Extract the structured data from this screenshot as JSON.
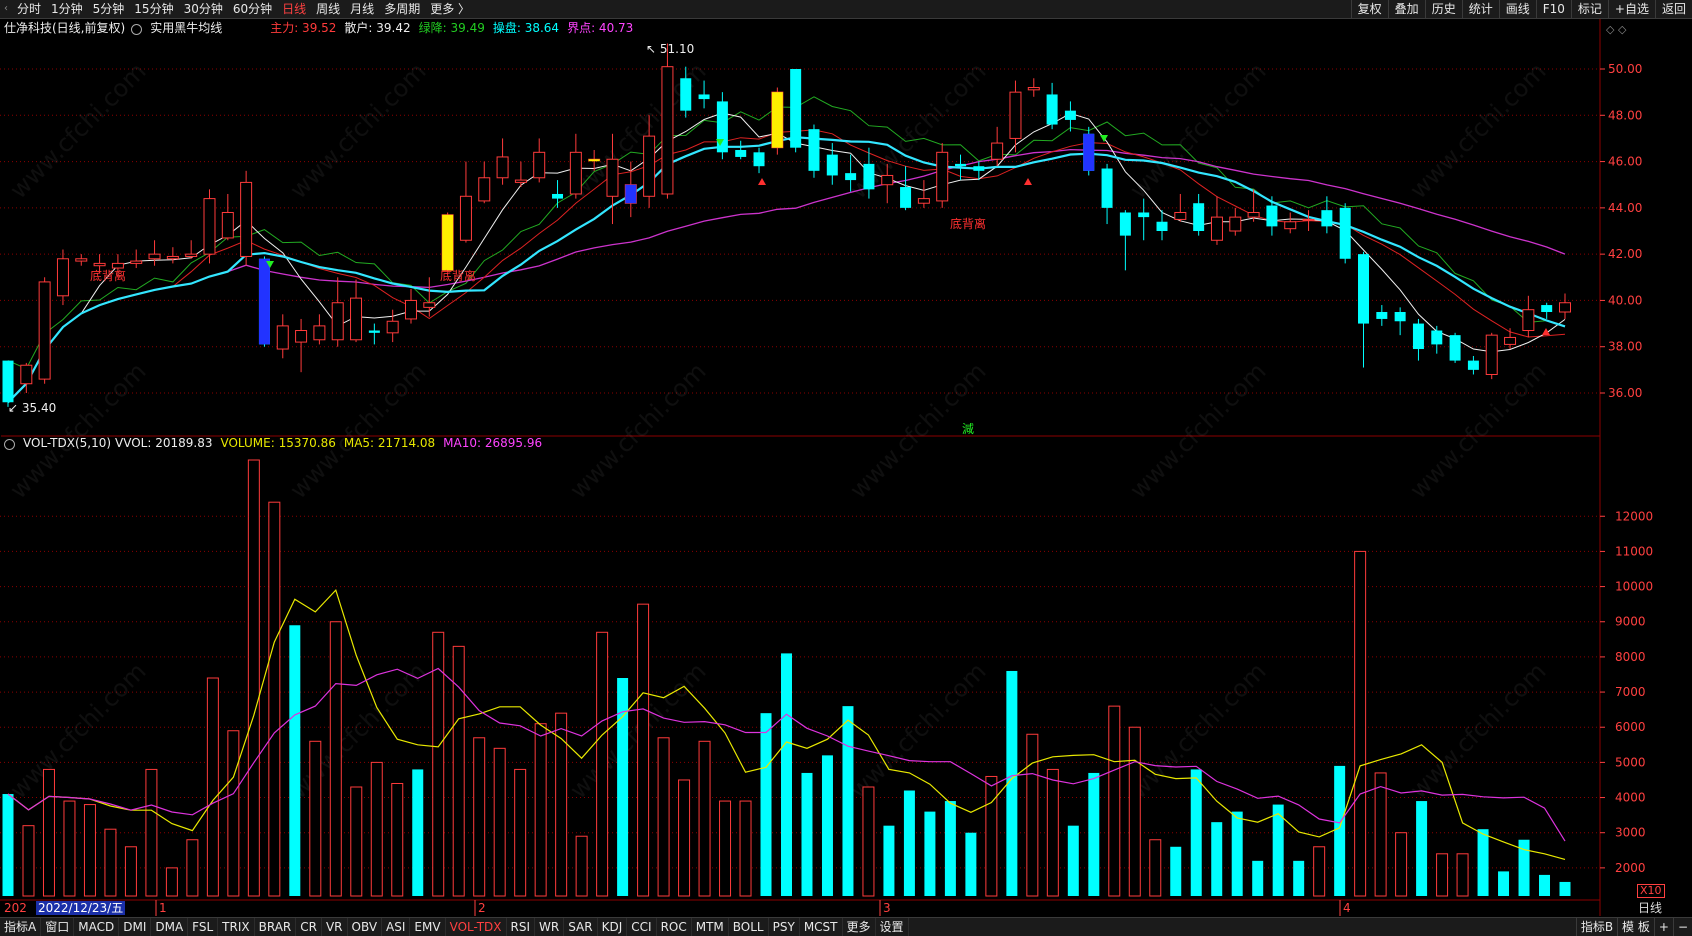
{
  "toolbar": {
    "periods": [
      "分时",
      "1分钟",
      "5分钟",
      "15分钟",
      "30分钟",
      "60分钟",
      "日线",
      "周线",
      "月线",
      "多周期",
      "更多 〉"
    ],
    "active_period": "日线",
    "right_buttons": [
      "复权",
      "叠加",
      "历史",
      "统计",
      "画线",
      "F10",
      "标记",
      "+自选",
      "返回"
    ]
  },
  "main_info": {
    "title": "仕净科技(日线,前复权)",
    "indicator": "实用黑牛均线",
    "zhuli": "主力: 39.52",
    "sanhu": "散户: 39.42",
    "lvjiang": "绿降: 39.49",
    "caopan": "操盘: 38.64",
    "jiedian": "界点: 40.73"
  },
  "vol_info": {
    "name": "VOL-TDX(5,10)",
    "vvol": "VVOL: 20189.83",
    "volume": "VOLUME: 15370.86",
    "ma5": "MA5: 21714.08",
    "ma10": "MA10: 26895.96"
  },
  "annotations": {
    "high": "51.10",
    "low": "35.40",
    "mark1": "底背离",
    "mark2": "底背离",
    "mark3": "底背离",
    "jian": "減"
  },
  "price_axis": [
    "50.00",
    "48.00",
    "46.00",
    "44.00",
    "42.00",
    "40.00",
    "38.00",
    "36.00"
  ],
  "vol_axis": [
    "12000",
    "11000",
    "10000",
    "9000",
    "8000",
    "7000",
    "6000",
    "5000",
    "4000",
    "3000",
    "2000"
  ],
  "x10": "X10",
  "date_label": "2022/12/23/五",
  "month_marks": [
    "1",
    "2",
    "3",
    "4"
  ],
  "year_prefix": "202",
  "day_mode": "日线",
  "bottom_tabs": [
    "指标A",
    "窗口",
    "MACD",
    "DMI",
    "DMA",
    "FSL",
    "TRIX",
    "BRAR",
    "CR",
    "VR",
    "OBV",
    "ASI",
    "EMV",
    "VOL-TDX",
    "RSI",
    "WR",
    "SAR",
    "KDJ",
    "CCI",
    "ROC",
    "MTM",
    "BOLL",
    "PSY",
    "MCST",
    "更多",
    "设置"
  ],
  "active_tab": "VOL-TDX",
  "bottom_right": [
    "指标B",
    "模 板",
    "+",
    "−"
  ],
  "colors": {
    "up": "#ff3b3b",
    "down": "#00ffff",
    "bg": "#000000",
    "grid": "#8b0000"
  },
  "chart_data": {
    "type": "candlestick",
    "candles": [
      [
        37.4,
        35.6,
        37.4,
        35.4
      ],
      [
        36.4,
        37.2,
        37.3,
        36.0
      ],
      [
        36.6,
        40.8,
        41.0,
        36.4
      ],
      [
        40.2,
        41.8,
        42.2,
        39.8
      ],
      [
        41.7,
        41.8,
        42.0,
        41.5
      ],
      [
        41.5,
        41.6,
        42.0,
        41.2
      ],
      [
        41.4,
        41.6,
        42.0,
        41.0
      ],
      [
        41.6,
        41.7,
        42.2,
        41.4
      ],
      [
        41.8,
        42.0,
        42.6,
        41.5
      ],
      [
        41.8,
        41.9,
        42.3,
        41.6
      ],
      [
        41.9,
        42.0,
        42.6,
        41.8
      ],
      [
        42.0,
        44.4,
        44.8,
        41.6
      ],
      [
        42.7,
        43.8,
        44.6,
        42.6
      ],
      [
        41.9,
        45.1,
        45.6,
        41.5
      ],
      [
        41.8,
        38.1,
        41.9,
        38.0
      ],
      [
        37.9,
        38.9,
        39.4,
        37.5
      ],
      [
        38.2,
        38.7,
        39.2,
        36.9
      ],
      [
        38.3,
        38.9,
        39.4,
        38.1
      ],
      [
        38.3,
        39.9,
        41.0,
        38.0
      ],
      [
        38.3,
        40.1,
        40.9,
        38.2
      ],
      [
        38.7,
        38.6,
        39.0,
        38.1
      ],
      [
        38.6,
        39.1,
        39.6,
        38.2
      ],
      [
        39.2,
        40.0,
        40.5,
        39.0
      ],
      [
        39.7,
        39.9,
        41.0,
        39.3
      ],
      [
        41.3,
        43.7,
        43.8,
        41.2
      ],
      [
        42.6,
        44.5,
        46.0,
        42.5
      ],
      [
        44.3,
        45.3,
        46.0,
        44.2
      ],
      [
        45.3,
        46.2,
        47.0,
        45.0
      ],
      [
        45.1,
        45.2,
        46.0,
        44.9
      ],
      [
        45.3,
        46.4,
        47.0,
        45.1
      ],
      [
        44.6,
        44.4,
        45.2,
        44.0
      ],
      [
        44.6,
        46.4,
        47.2,
        44.4
      ],
      [
        46.1,
        46.1,
        46.5,
        45.6
      ],
      [
        44.5,
        46.1,
        47.2,
        43.3
      ],
      [
        44.2,
        45.0,
        46.0,
        43.6
      ],
      [
        44.5,
        47.1,
        48.0,
        44.0
      ],
      [
        44.6,
        50.1,
        51.1,
        44.4
      ],
      [
        49.6,
        48.2,
        50.1,
        47.9
      ],
      [
        48.9,
        48.7,
        49.5,
        48.3
      ],
      [
        48.6,
        46.4,
        49.0,
        46.1
      ],
      [
        46.5,
        46.2,
        46.9,
        46.1
      ],
      [
        46.4,
        45.8,
        46.6,
        45.5
      ],
      [
        46.6,
        49.0,
        49.2,
        46.3
      ],
      [
        50.0,
        46.6,
        50.0,
        46.4
      ],
      [
        47.4,
        45.6,
        47.6,
        45.3
      ],
      [
        46.3,
        45.4,
        46.8,
        45.0
      ],
      [
        45.5,
        45.2,
        46.3,
        44.7
      ],
      [
        45.9,
        44.8,
        46.6,
        44.4
      ],
      [
        45.0,
        45.4,
        45.9,
        44.2
      ],
      [
        44.9,
        44.0,
        45.8,
        43.9
      ],
      [
        44.2,
        44.4,
        45.2,
        44.0
      ],
      [
        44.3,
        46.4,
        46.8,
        44.0
      ],
      [
        45.9,
        45.8,
        46.3,
        45.2
      ],
      [
        45.8,
        45.6,
        46.0,
        45.2
      ],
      [
        46.1,
        46.8,
        47.5,
        45.8
      ],
      [
        47.0,
        49.0,
        49.5,
        46.4
      ],
      [
        49.1,
        49.2,
        49.6,
        48.8
      ],
      [
        48.9,
        47.6,
        49.4,
        47.4
      ],
      [
        48.2,
        47.8,
        48.6,
        47.3
      ],
      [
        47.2,
        45.6,
        47.5,
        45.4
      ],
      [
        45.7,
        44.0,
        45.9,
        43.3
      ],
      [
        43.8,
        42.8,
        43.9,
        41.3
      ],
      [
        43.8,
        43.6,
        44.4,
        42.6
      ],
      [
        43.4,
        43.0,
        43.9,
        42.6
      ],
      [
        43.5,
        43.8,
        44.6,
        43.4
      ],
      [
        44.2,
        43.0,
        44.6,
        42.8
      ],
      [
        42.6,
        43.6,
        44.5,
        42.4
      ],
      [
        43.0,
        43.6,
        44.0,
        42.8
      ],
      [
        43.6,
        43.8,
        44.8,
        43.4
      ],
      [
        44.1,
        43.2,
        44.5,
        42.8
      ],
      [
        43.1,
        43.4,
        43.8,
        42.9
      ],
      [
        43.5,
        43.5,
        43.9,
        43.0
      ],
      [
        43.9,
        43.2,
        44.5,
        42.9
      ],
      [
        44.0,
        41.8,
        44.2,
        41.6
      ],
      [
        42.0,
        39.0,
        42.1,
        37.1
      ],
      [
        39.5,
        39.2,
        39.8,
        38.9
      ],
      [
        39.5,
        39.1,
        39.7,
        38.5
      ],
      [
        39.0,
        37.9,
        39.2,
        37.4
      ],
      [
        38.7,
        38.1,
        38.9,
        37.7
      ],
      [
        38.5,
        37.4,
        38.6,
        37.3
      ],
      [
        37.4,
        37.0,
        37.6,
        36.8
      ],
      [
        36.8,
        38.5,
        38.6,
        36.6
      ],
      [
        38.1,
        38.4,
        38.8,
        37.9
      ],
      [
        38.7,
        39.6,
        40.2,
        38.4
      ],
      [
        39.8,
        39.5,
        39.9,
        39.2
      ],
      [
        39.5,
        39.9,
        40.3,
        39.2
      ]
    ],
    "volume": [
      4100,
      3200,
      4800,
      3900,
      3800,
      3100,
      2600,
      4800,
      2000,
      2800,
      7400,
      5900,
      13600,
      12400,
      8900,
      5600,
      9000,
      4300,
      5000,
      4400,
      4800,
      8700,
      8300,
      5700,
      5400,
      4800,
      6100,
      6400,
      2900,
      8700,
      7400,
      9500,
      5700,
      4500,
      5600,
      3900,
      3900,
      6400,
      8100,
      4700,
      5200,
      6600,
      4300,
      3200,
      4200,
      3600,
      3900,
      3000,
      4600,
      7600,
      5800,
      4800,
      3200,
      4700,
      6600,
      6000,
      2800,
      2600,
      4800,
      3300,
      3600,
      2200,
      3800,
      2200,
      2600,
      4900,
      11000,
      4700,
      3000,
      3900,
      2400,
      2400,
      3100,
      1900,
      2800,
      1800,
      1600
    ],
    "ma_price_range": [
      35.4,
      51.1
    ],
    "price_ylim": [
      35.4,
      51.0
    ],
    "vol_ylim": [
      1200,
      13600
    ]
  }
}
